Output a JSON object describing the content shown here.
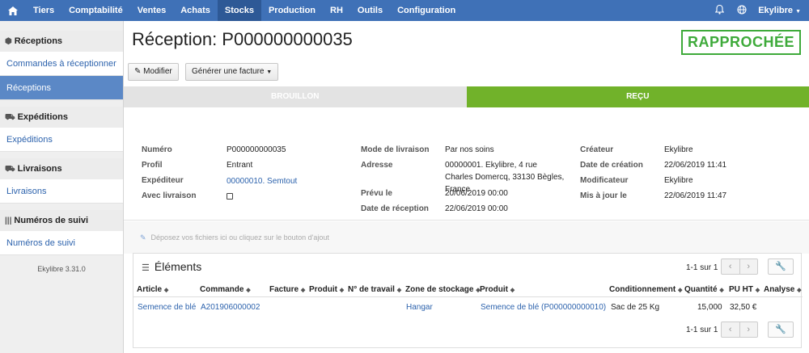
{
  "topnav": {
    "items": [
      "Tiers",
      "Comptabilité",
      "Ventes",
      "Achats",
      "Stocks",
      "Production",
      "RH",
      "Outils",
      "Configuration"
    ],
    "active": "Stocks",
    "user": "Ekylibre"
  },
  "sidebar": {
    "sections": [
      {
        "heading": "Réceptions",
        "links": [
          "Commandes à réceptionner",
          "Réceptions"
        ]
      },
      {
        "heading": "Expéditions",
        "links": [
          "Expéditions"
        ]
      },
      {
        "heading": "Livraisons",
        "links": [
          "Livraisons"
        ]
      },
      {
        "heading": "Numéros de suivi",
        "links": [
          "Numéros de suivi"
        ]
      }
    ],
    "active_link": "Réceptions",
    "version": "Ekylibre 3.31.0"
  },
  "page": {
    "title": "Réception: P000000000035",
    "status": "RAPPROCHÉE",
    "buttons": {
      "modify": "Modifier",
      "generate": "Générer une facture"
    },
    "steps": [
      "BROUILLON",
      "REÇU"
    ]
  },
  "details": {
    "col1": [
      {
        "label": "Numéro",
        "value": "P000000000035"
      },
      {
        "label": "Profil",
        "value": "Entrant"
      },
      {
        "label": "Expéditeur",
        "value": "00000010. Semtout"
      },
      {
        "label": "Avec livraison",
        "value": ""
      }
    ],
    "col2": [
      {
        "label": "Mode de livraison",
        "value": "Par nos soins"
      },
      {
        "label": "Adresse",
        "value": "00000001. Ekylibre, 4 rue Charles Domercq, 33130 Bègles, France"
      },
      {
        "label": "Prévu le",
        "value": "20/06/2019 00:00"
      },
      {
        "label": "Date de réception",
        "value": "22/06/2019 00:00"
      }
    ],
    "col3": [
      {
        "label": "Créateur",
        "value": "Ekylibre"
      },
      {
        "label": "Date de création",
        "value": "22/06/2019 11:41"
      },
      {
        "label": "Modificateur",
        "value": "Ekylibre"
      },
      {
        "label": "Mis à jour le",
        "value": "22/06/2019 11:47"
      }
    ]
  },
  "dropzone": "Déposez vos fichiers ici ou cliquez sur le bouton d'ajout",
  "elements": {
    "title": "Éléments",
    "pager": "1-1 sur 1",
    "columns": [
      "Article",
      "Commande",
      "Facture",
      "Produit",
      "N° de travail",
      "Zone de stockage",
      "Produit",
      "Conditionnement",
      "Quantité",
      "PU HT",
      "Analyse"
    ],
    "rows": [
      [
        "Semence de blé",
        "A201906000002",
        "",
        "",
        "",
        "Hangar",
        "Semence de blé (P000000000010)",
        "Sac de 25 Kg",
        "15,000",
        "32,50 €",
        ""
      ]
    ]
  }
}
